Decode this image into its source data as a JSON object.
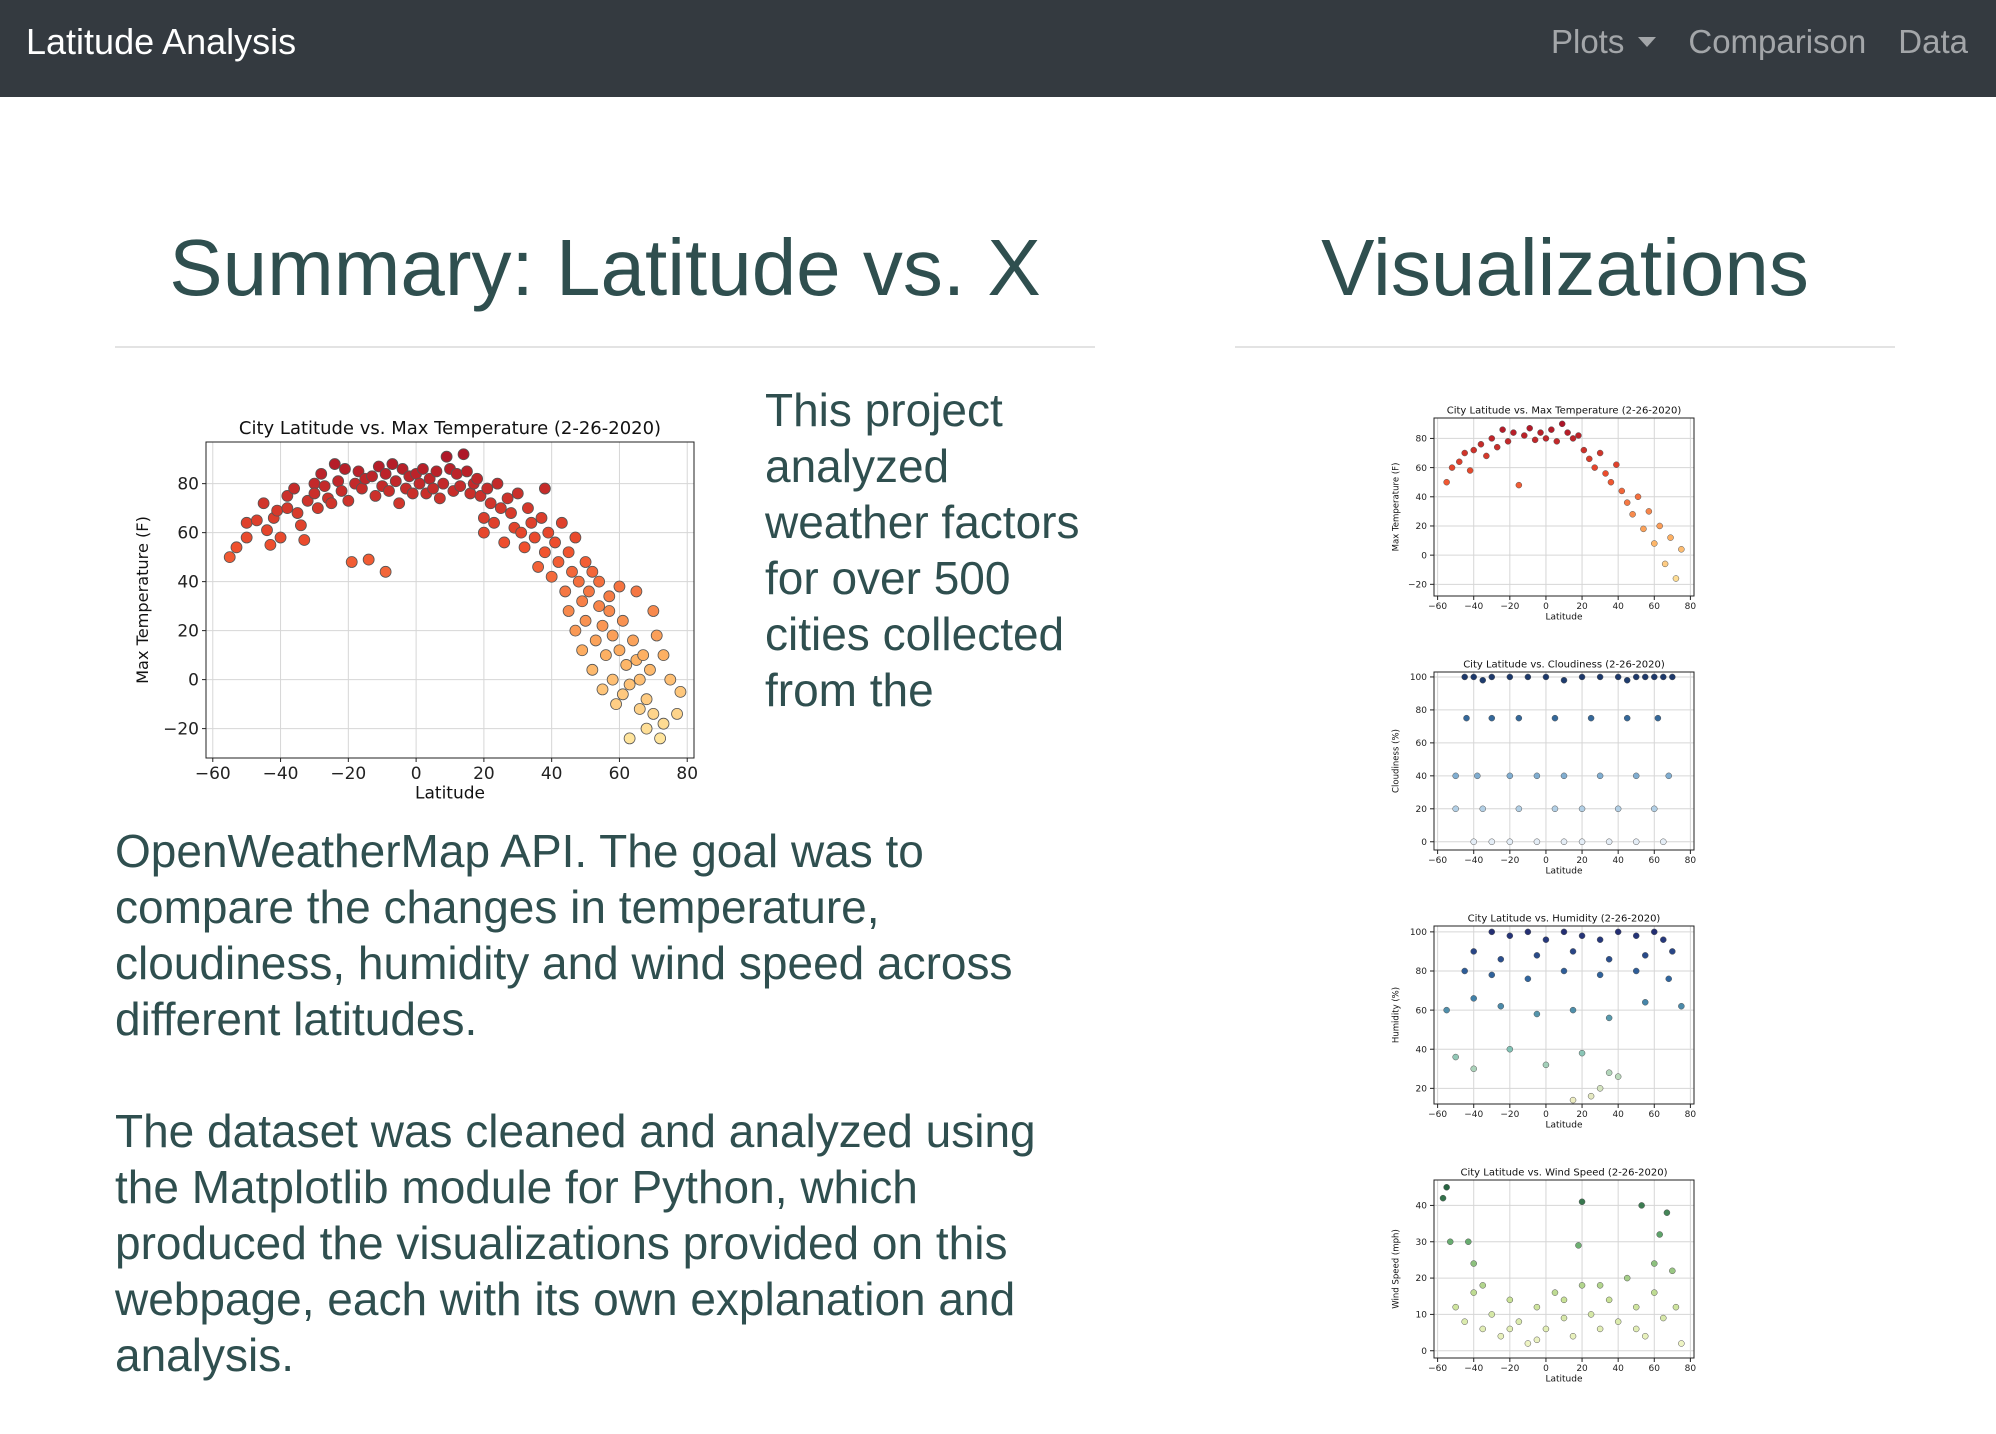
{
  "navbar": {
    "brand": "Latitude Analysis",
    "links": [
      {
        "label": "Plots",
        "dropdown": true
      },
      {
        "label": "Comparison"
      },
      {
        "label": "Data"
      }
    ],
    "colors": {
      "background": "#343a40",
      "brand": "#ffffff",
      "link": "rgba(255,255,255,0.55)"
    }
  },
  "summary": {
    "heading": "Summary: Latitude vs. X",
    "paragraph_1": "This project analyzed weather factors for over 500 cities collected from the",
    "paragraph_1_cont": "OpenWeatherMap API. The goal was to compare the changes in temperature, cloudiness, humidity and wind speed across different latitudes.",
    "paragraph_2": "The dataset was cleaned and analyzed using the Matplotlib module for Python, which produced the visualizations provided on this webpage, each with its own explanation and analysis."
  },
  "visualizations": {
    "heading": "Visualizations"
  },
  "text_color": "#2f4f4f",
  "chart_data": [
    {
      "type": "scatter",
      "role": "summary",
      "title": "City Latitude vs. Max Temperature (2-26-2020)",
      "xlabel": "Latitude",
      "ylabel": "Max Temperature (F)",
      "xlim": [
        -62,
        82
      ],
      "ylim": [
        -32,
        97
      ],
      "xticks": [
        -60,
        -40,
        -20,
        0,
        20,
        40,
        60,
        80
      ],
      "yticks": [
        -20,
        0,
        20,
        40,
        60,
        80
      ],
      "grid": true,
      "colormap": "YlOrRd (values are color-mapped)",
      "points": [
        [
          -55,
          50
        ],
        [
          -53,
          54
        ],
        [
          -50,
          58
        ],
        [
          -50,
          64
        ],
        [
          -47,
          65
        ],
        [
          -45,
          72
        ],
        [
          -44,
          61
        ],
        [
          -43,
          55
        ],
        [
          -42,
          66
        ],
        [
          -41,
          69
        ],
        [
          -40,
          58
        ],
        [
          -38,
          70
        ],
        [
          -38,
          75
        ],
        [
          -36,
          78
        ],
        [
          -35,
          68
        ],
        [
          -34,
          63
        ],
        [
          -33,
          57
        ],
        [
          -32,
          73
        ],
        [
          -30,
          80
        ],
        [
          -30,
          76
        ],
        [
          -29,
          70
        ],
        [
          -28,
          84
        ],
        [
          -27,
          79
        ],
        [
          -26,
          74
        ],
        [
          -25,
          72
        ],
        [
          -24,
          88
        ],
        [
          -23,
          81
        ],
        [
          -22,
          77
        ],
        [
          -21,
          86
        ],
        [
          -20,
          73
        ],
        [
          -19,
          48
        ],
        [
          -18,
          80
        ],
        [
          -17,
          85
        ],
        [
          -16,
          78
        ],
        [
          -15,
          82
        ],
        [
          -14,
          49
        ],
        [
          -13,
          83
        ],
        [
          -12,
          75
        ],
        [
          -11,
          87
        ],
        [
          -10,
          79
        ],
        [
          -9,
          44
        ],
        [
          -9,
          84
        ],
        [
          -8,
          77
        ],
        [
          -7,
          88
        ],
        [
          -6,
          81
        ],
        [
          -5,
          72
        ],
        [
          -4,
          86
        ],
        [
          -3,
          78
        ],
        [
          -2,
          83
        ],
        [
          -1,
          76
        ],
        [
          0,
          84
        ],
        [
          1,
          80
        ],
        [
          2,
          86
        ],
        [
          3,
          76
        ],
        [
          4,
          82
        ],
        [
          5,
          78
        ],
        [
          6,
          85
        ],
        [
          7,
          74
        ],
        [
          8,
          80
        ],
        [
          9,
          91
        ],
        [
          10,
          86
        ],
        [
          11,
          77
        ],
        [
          12,
          84
        ],
        [
          13,
          79
        ],
        [
          14,
          92
        ],
        [
          15,
          85
        ],
        [
          16,
          76
        ],
        [
          17,
          80
        ],
        [
          18,
          82
        ],
        [
          19,
          75
        ],
        [
          20,
          66
        ],
        [
          20,
          60
        ],
        [
          21,
          78
        ],
        [
          22,
          72
        ],
        [
          23,
          64
        ],
        [
          24,
          80
        ],
        [
          25,
          70
        ],
        [
          26,
          56
        ],
        [
          27,
          74
        ],
        [
          28,
          68
        ],
        [
          29,
          62
        ],
        [
          30,
          76
        ],
        [
          31,
          60
        ],
        [
          32,
          54
        ],
        [
          33,
          70
        ],
        [
          34,
          64
        ],
        [
          35,
          58
        ],
        [
          36,
          46
        ],
        [
          37,
          66
        ],
        [
          38,
          78
        ],
        [
          38,
          52
        ],
        [
          39,
          60
        ],
        [
          40,
          42
        ],
        [
          41,
          56
        ],
        [
          42,
          48
        ],
        [
          43,
          64
        ],
        [
          44,
          36
        ],
        [
          45,
          52
        ],
        [
          45,
          28
        ],
        [
          46,
          44
        ],
        [
          47,
          58
        ],
        [
          47,
          20
        ],
        [
          48,
          40
        ],
        [
          49,
          32
        ],
        [
          49,
          12
        ],
        [
          50,
          48
        ],
        [
          50,
          24
        ],
        [
          51,
          36
        ],
        [
          52,
          4
        ],
        [
          52,
          44
        ],
        [
          53,
          16
        ],
        [
          54,
          30
        ],
        [
          54,
          40
        ],
        [
          55,
          22
        ],
        [
          55,
          -4
        ],
        [
          56,
          10
        ],
        [
          57,
          34
        ],
        [
          57,
          28
        ],
        [
          58,
          0
        ],
        [
          58,
          18
        ],
        [
          59,
          -10
        ],
        [
          60,
          12
        ],
        [
          60,
          38
        ],
        [
          61,
          -6
        ],
        [
          61,
          24
        ],
        [
          62,
          6
        ],
        [
          63,
          -24
        ],
        [
          63,
          -2
        ],
        [
          64,
          16
        ],
        [
          65,
          8
        ],
        [
          65,
          36
        ],
        [
          66,
          -12
        ],
        [
          66,
          0
        ],
        [
          67,
          10
        ],
        [
          68,
          -8
        ],
        [
          68,
          -20
        ],
        [
          69,
          4
        ],
        [
          70,
          28
        ],
        [
          70,
          -14
        ],
        [
          71,
          18
        ],
        [
          72,
          -24
        ],
        [
          73,
          10
        ],
        [
          73,
          -18
        ],
        [
          75,
          0
        ],
        [
          77,
          -14
        ],
        [
          78,
          -5
        ]
      ]
    },
    {
      "type": "scatter",
      "role": "thumbnail",
      "title": "City Latitude vs. Max Temperature (2-26-2020)",
      "xlabel": "Latitude",
      "ylabel": "Max Temperature (F)",
      "xlim": [
        -62,
        82
      ],
      "ylim": [
        -28,
        94
      ],
      "xticks": [
        -60,
        -40,
        -20,
        0,
        20,
        40,
        60,
        80
      ],
      "yticks": [
        -20,
        0,
        20,
        40,
        60,
        80
      ],
      "grid": true,
      "colormap": "YlOrRd (values are color-mapped)",
      "points": [
        [
          -55,
          50
        ],
        [
          -52,
          60
        ],
        [
          -48,
          64
        ],
        [
          -45,
          70
        ],
        [
          -42,
          58
        ],
        [
          -40,
          72
        ],
        [
          -36,
          76
        ],
        [
          -33,
          68
        ],
        [
          -30,
          80
        ],
        [
          -27,
          74
        ],
        [
          -24,
          86
        ],
        [
          -21,
          78
        ],
        [
          -18,
          84
        ],
        [
          -15,
          48
        ],
        [
          -12,
          82
        ],
        [
          -9,
          87
        ],
        [
          -6,
          79
        ],
        [
          -3,
          84
        ],
        [
          0,
          80
        ],
        [
          3,
          86
        ],
        [
          6,
          78
        ],
        [
          9,
          90
        ],
        [
          12,
          84
        ],
        [
          15,
          80
        ],
        [
          18,
          82
        ],
        [
          21,
          72
        ],
        [
          24,
          66
        ],
        [
          27,
          60
        ],
        [
          30,
          70
        ],
        [
          33,
          56
        ],
        [
          36,
          50
        ],
        [
          39,
          62
        ],
        [
          42,
          44
        ],
        [
          45,
          36
        ],
        [
          48,
          28
        ],
        [
          51,
          40
        ],
        [
          54,
          18
        ],
        [
          57,
          30
        ],
        [
          60,
          8
        ],
        [
          63,
          20
        ],
        [
          66,
          -6
        ],
        [
          69,
          12
        ],
        [
          72,
          -16
        ],
        [
          75,
          4
        ]
      ]
    },
    {
      "type": "scatter",
      "role": "thumbnail",
      "title": "City Latitude vs. Cloudiness (2-26-2020)",
      "xlabel": "Latitude",
      "ylabel": "Cloudiness (%)",
      "xlim": [
        -62,
        82
      ],
      "ylim": [
        -5,
        103
      ],
      "xticks": [
        -60,
        -40,
        -20,
        0,
        20,
        40,
        60,
        80
      ],
      "yticks": [
        0,
        20,
        40,
        60,
        80,
        100
      ],
      "grid": true,
      "colormap": "Blues (values are color-mapped)",
      "points": [
        [
          -45,
          100
        ],
        [
          -40,
          100
        ],
        [
          -35,
          98
        ],
        [
          -30,
          100
        ],
        [
          -20,
          100
        ],
        [
          -10,
          100
        ],
        [
          0,
          100
        ],
        [
          10,
          98
        ],
        [
          20,
          100
        ],
        [
          30,
          100
        ],
        [
          40,
          100
        ],
        [
          45,
          98
        ],
        [
          50,
          100
        ],
        [
          55,
          100
        ],
        [
          60,
          100
        ],
        [
          65,
          100
        ],
        [
          70,
          100
        ],
        [
          -44,
          75
        ],
        [
          -30,
          75
        ],
        [
          -15,
          75
        ],
        [
          5,
          75
        ],
        [
          25,
          75
        ],
        [
          45,
          75
        ],
        [
          62,
          75
        ],
        [
          -50,
          40
        ],
        [
          -38,
          40
        ],
        [
          -20,
          40
        ],
        [
          -5,
          40
        ],
        [
          10,
          40
        ],
        [
          30,
          40
        ],
        [
          50,
          40
        ],
        [
          68,
          40
        ],
        [
          -50,
          20
        ],
        [
          -35,
          20
        ],
        [
          -15,
          20
        ],
        [
          5,
          20
        ],
        [
          20,
          20
        ],
        [
          40,
          20
        ],
        [
          60,
          20
        ],
        [
          -40,
          0
        ],
        [
          -30,
          0
        ],
        [
          -20,
          0
        ],
        [
          -5,
          0
        ],
        [
          10,
          0
        ],
        [
          20,
          0
        ],
        [
          35,
          0
        ],
        [
          50,
          0
        ],
        [
          65,
          0
        ]
      ]
    },
    {
      "type": "scatter",
      "role": "thumbnail",
      "title": "City Latitude vs. Humidity (2-26-2020)",
      "xlabel": "Latitude",
      "ylabel": "Humidity (%)",
      "xlim": [
        -62,
        82
      ],
      "ylim": [
        12,
        103
      ],
      "xticks": [
        -60,
        -40,
        -20,
        0,
        20,
        40,
        60,
        80
      ],
      "yticks": [
        20,
        40,
        60,
        80,
        100
      ],
      "grid": true,
      "colormap": "YlGnBu (values are color-mapped)",
      "points": [
        [
          -30,
          100
        ],
        [
          -20,
          98
        ],
        [
          -10,
          100
        ],
        [
          0,
          96
        ],
        [
          10,
          100
        ],
        [
          20,
          98
        ],
        [
          30,
          96
        ],
        [
          40,
          100
        ],
        [
          50,
          98
        ],
        [
          60,
          100
        ],
        [
          65,
          96
        ],
        [
          -40,
          90
        ],
        [
          -25,
          86
        ],
        [
          -5,
          88
        ],
        [
          15,
          90
        ],
        [
          35,
          86
        ],
        [
          55,
          88
        ],
        [
          70,
          90
        ],
        [
          -45,
          80
        ],
        [
          -30,
          78
        ],
        [
          -10,
          76
        ],
        [
          10,
          80
        ],
        [
          30,
          78
        ],
        [
          50,
          80
        ],
        [
          68,
          76
        ],
        [
          -55,
          60
        ],
        [
          -40,
          66
        ],
        [
          -25,
          62
        ],
        [
          -5,
          58
        ],
        [
          15,
          60
        ],
        [
          35,
          56
        ],
        [
          55,
          64
        ],
        [
          75,
          62
        ],
        [
          -50,
          36
        ],
        [
          -40,
          30
        ],
        [
          -20,
          40
        ],
        [
          0,
          32
        ],
        [
          20,
          38
        ],
        [
          30,
          20
        ],
        [
          40,
          26
        ],
        [
          15,
          14
        ],
        [
          25,
          16
        ],
        [
          35,
          28
        ]
      ]
    },
    {
      "type": "scatter",
      "role": "thumbnail",
      "title": "City Latitude vs. Wind Speed (2-26-2020)",
      "xlabel": "Latitude",
      "ylabel": "Wind Speed (mph)",
      "xlim": [
        -62,
        82
      ],
      "ylim": [
        -2,
        47
      ],
      "xticks": [
        -60,
        -40,
        -20,
        0,
        20,
        40,
        60,
        80
      ],
      "yticks": [
        0,
        10,
        20,
        30,
        40
      ],
      "grid": true,
      "colormap": "YlGn (values are color-mapped)",
      "points": [
        [
          -57,
          42
        ],
        [
          -55,
          45
        ],
        [
          -53,
          30
        ],
        [
          -43,
          30
        ],
        [
          -40,
          24
        ],
        [
          20,
          41
        ],
        [
          53,
          40
        ],
        [
          18,
          29
        ],
        [
          63,
          32
        ],
        [
          67,
          38
        ],
        [
          -50,
          12
        ],
        [
          -45,
          8
        ],
        [
          -40,
          16
        ],
        [
          -35,
          6
        ],
        [
          -30,
          10
        ],
        [
          -25,
          4
        ],
        [
          -20,
          14
        ],
        [
          -15,
          8
        ],
        [
          -10,
          2
        ],
        [
          -5,
          12
        ],
        [
          0,
          6
        ],
        [
          5,
          16
        ],
        [
          10,
          9
        ],
        [
          15,
          4
        ],
        [
          20,
          18
        ],
        [
          25,
          10
        ],
        [
          30,
          6
        ],
        [
          35,
          14
        ],
        [
          40,
          8
        ],
        [
          45,
          20
        ],
        [
          50,
          12
        ],
        [
          55,
          4
        ],
        [
          60,
          16
        ],
        [
          65,
          9
        ],
        [
          70,
          22
        ],
        [
          75,
          2
        ],
        [
          -35,
          18
        ],
        [
          -20,
          6
        ],
        [
          -5,
          3
        ],
        [
          10,
          14
        ],
        [
          30,
          18
        ],
        [
          50,
          6
        ],
        [
          60,
          24
        ],
        [
          72,
          12
        ]
      ]
    }
  ]
}
